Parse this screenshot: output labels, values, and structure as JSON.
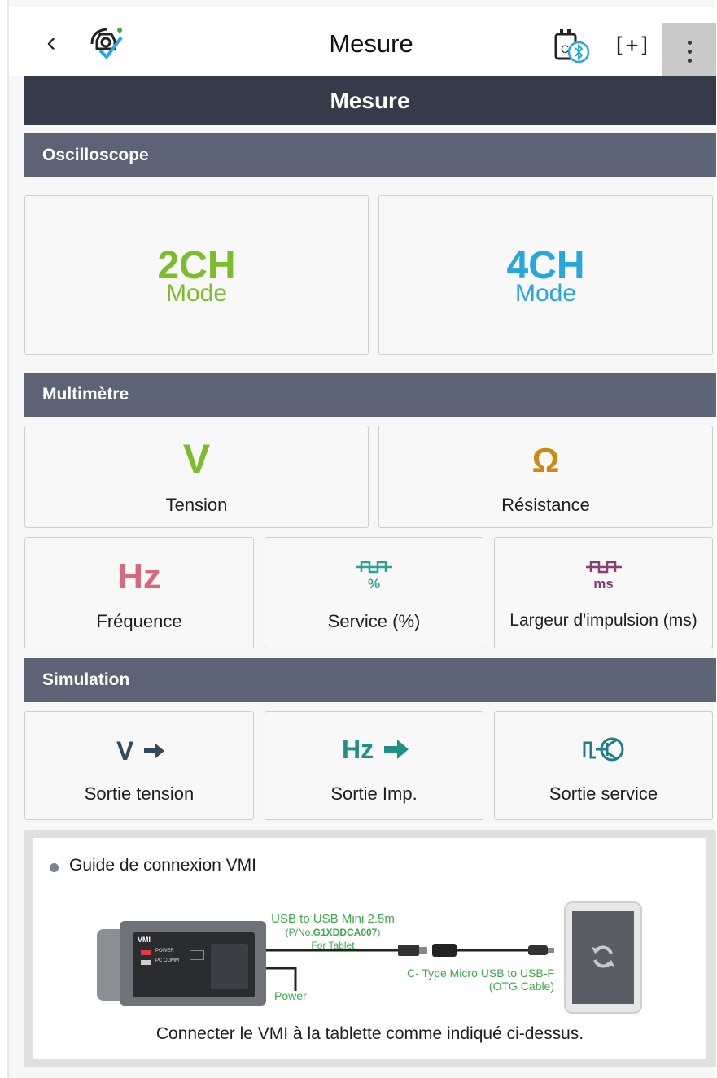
{
  "topbar": {
    "back_icon": "chevron-left-icon",
    "brand_icon": "car-check-icon",
    "title": "Mesure",
    "vci_icon": "vci-bluetooth-icon",
    "capture_icon": "screen-capture-icon",
    "more_icon": "more-vertical-icon"
  },
  "page_title": "Mesure",
  "oscilloscope": {
    "section_label": "Oscilloscope",
    "modes": [
      {
        "big": "2CH",
        "small": "Mode",
        "color": "#7bbd2a"
      },
      {
        "big": "4CH",
        "small": "Mode",
        "color": "#28a6e0"
      }
    ]
  },
  "multimeter": {
    "section_label": "Multimètre",
    "tension": {
      "symbol": "V",
      "label": "Tension",
      "color": "#7bbd2a"
    },
    "resistance": {
      "symbol": "Ω",
      "label": "Résistance",
      "color": "#cc8a12"
    },
    "frequency": {
      "symbol": "Hz",
      "label": "Fréquence",
      "color": "#d9667a"
    },
    "duty": {
      "symbol": "%",
      "label": "Service (%)",
      "color": "#2aa394"
    },
    "pulse": {
      "symbol": "ms",
      "label": "Largeur d'impulsion (ms)",
      "color": "#8a3d77"
    }
  },
  "simulation": {
    "section_label": "Simulation",
    "items": [
      {
        "symbol": "V",
        "label": "Sortie tension",
        "color": "#34495e"
      },
      {
        "symbol": "Hz",
        "label": "Sortie Imp.",
        "color": "#1f8f88"
      },
      {
        "symbol": "",
        "label": "Sortie service",
        "color": "#1f7f88"
      }
    ]
  },
  "guide": {
    "title": "Guide de connexion VMI",
    "cable1_line1": "USB to USB Mini 2.5m",
    "cable1_pno_prefix": "(P/No.",
    "cable1_pno": "G1XDDCA007",
    "cable1_pno_suffix": ")",
    "cable1_line3": "For Tablet",
    "power_label": "Power",
    "otg_line1": "C- Type Micro USB to USB-F",
    "otg_line2": "(OTG Cable)",
    "device_brand": "VMI",
    "device_power": "POWER",
    "device_pccomm": "PC COMM",
    "note": "Connecter le VMI à la tablette comme indiqué ci-dessus."
  },
  "colors": {
    "title_band": "#353b48",
    "section": "#5c6374",
    "cable_green": "#3ea84b"
  }
}
